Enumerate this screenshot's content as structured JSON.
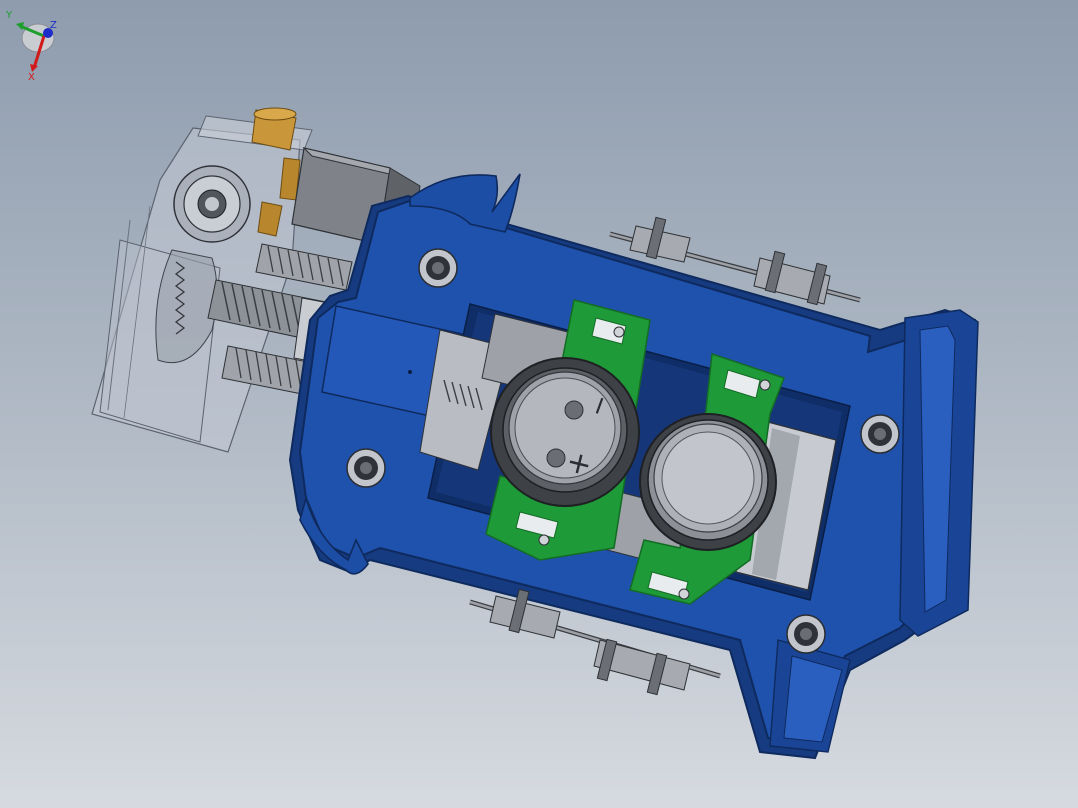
{
  "model": {
    "colors": {
      "frame": "#1d4ea6",
      "frame_dark": "#163b80",
      "frame_edge": "#0e2a5e",
      "bracket": "#1f9a38",
      "bracket_dark": "#136b24",
      "metal": "#8a8d92",
      "metal_dark": "#3e4145",
      "brass": "#b88a2e",
      "housing": "#c9ced6"
    },
    "cell_markings": {
      "minus": "−",
      "plus": "+"
    }
  },
  "triad": {
    "labels": {
      "y": "Y",
      "z": "Z",
      "x": "X"
    },
    "colors": {
      "y": "#1e9e2c",
      "z": "#1b2cc8",
      "x": "#d21a1a"
    }
  }
}
